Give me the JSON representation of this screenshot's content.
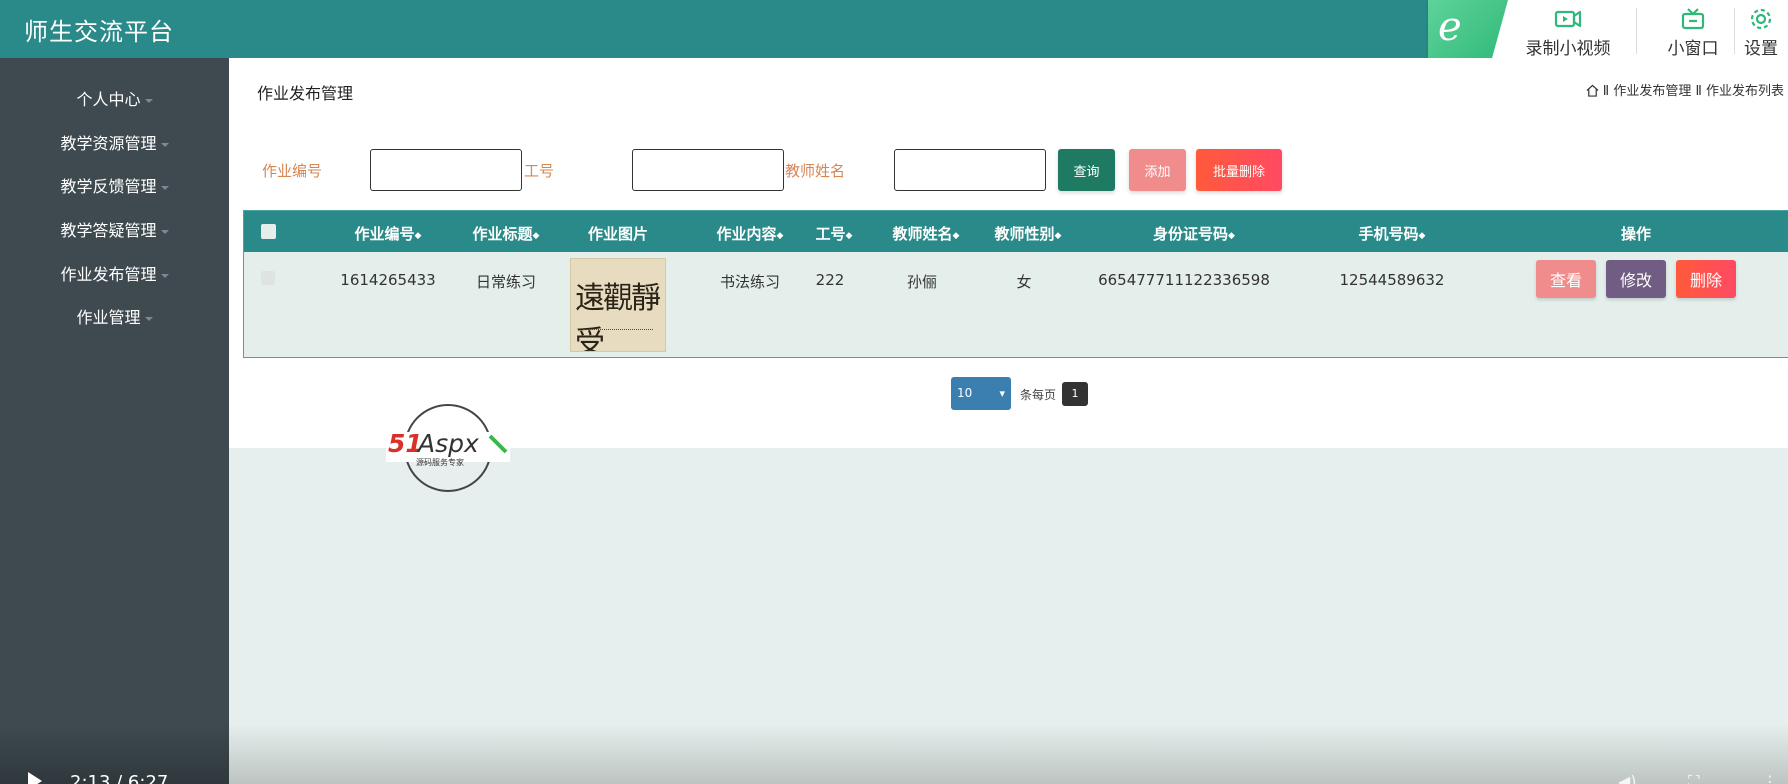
{
  "app": {
    "title": "师生交流平台"
  },
  "overlay": {
    "record_label": "录制小视频",
    "pip_label": "小窗口",
    "settings_label": "设置",
    "accent": "#2fb879"
  },
  "sidebar": {
    "items": [
      {
        "label": "个人中心"
      },
      {
        "label": "教学资源管理"
      },
      {
        "label": "教学反馈管理"
      },
      {
        "label": "教学答疑管理"
      },
      {
        "label": "作业发布管理"
      },
      {
        "label": "作业管理"
      }
    ]
  },
  "page": {
    "title": "作业发布管理",
    "breadcrumb": "Ⅱ 作业发布管理 Ⅱ 作业发布列表"
  },
  "filters": {
    "homework_no_label": "作业编号",
    "staff_no_label": "工号",
    "teacher_name_label": "教师姓名",
    "homework_no_value": "",
    "staff_no_value": "",
    "teacher_name_value": ""
  },
  "actions": {
    "search": "查询",
    "add": "添加",
    "batch_delete": "批量删除"
  },
  "table": {
    "headers": [
      "作业编号",
      "作业标题",
      "作业图片",
      "作业内容",
      "工号",
      "教师姓名",
      "教师性别",
      "身份证号码",
      "手机号码",
      "操作"
    ],
    "rows": [
      {
        "homework_no": "1614265433",
        "title": "日常练习",
        "image": "calligraphy-image",
        "content": "书法练习",
        "staff_no": "222",
        "teacher_name": "孙俪",
        "gender": "女",
        "id_card": "665477711122336598",
        "phone": "12544589632",
        "view": "查看",
        "edit": "修改",
        "delete": "删除"
      }
    ]
  },
  "pager": {
    "page_size": "10",
    "per_page_label": "条每页",
    "current_page": "1"
  },
  "watermark": {
    "brand": "51Aspx",
    "tagline": "源码服务专家"
  },
  "video": {
    "time": "2:13 / 6:27"
  },
  "colors": {
    "primary": "#2a8a89",
    "sidebar": "#3e4a50",
    "label": "#d58653",
    "danger": "#ff5a3b",
    "pink": "#f08c8c",
    "purple": "#715d83"
  }
}
